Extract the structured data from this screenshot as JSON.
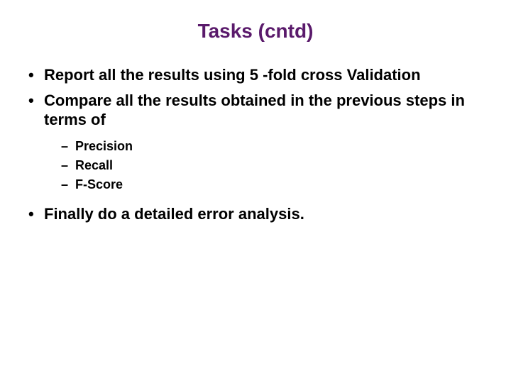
{
  "title": "Tasks (cntd)",
  "bullets": {
    "b1": "Report all the results using 5 -fold cross Validation",
    "b2": "Compare all the results obtained in the previous steps in terms of",
    "b3": "Finally do a detailed error analysis."
  },
  "sub": {
    "s1": "Precision",
    "s2": "Recall",
    "s3": "F-Score"
  }
}
